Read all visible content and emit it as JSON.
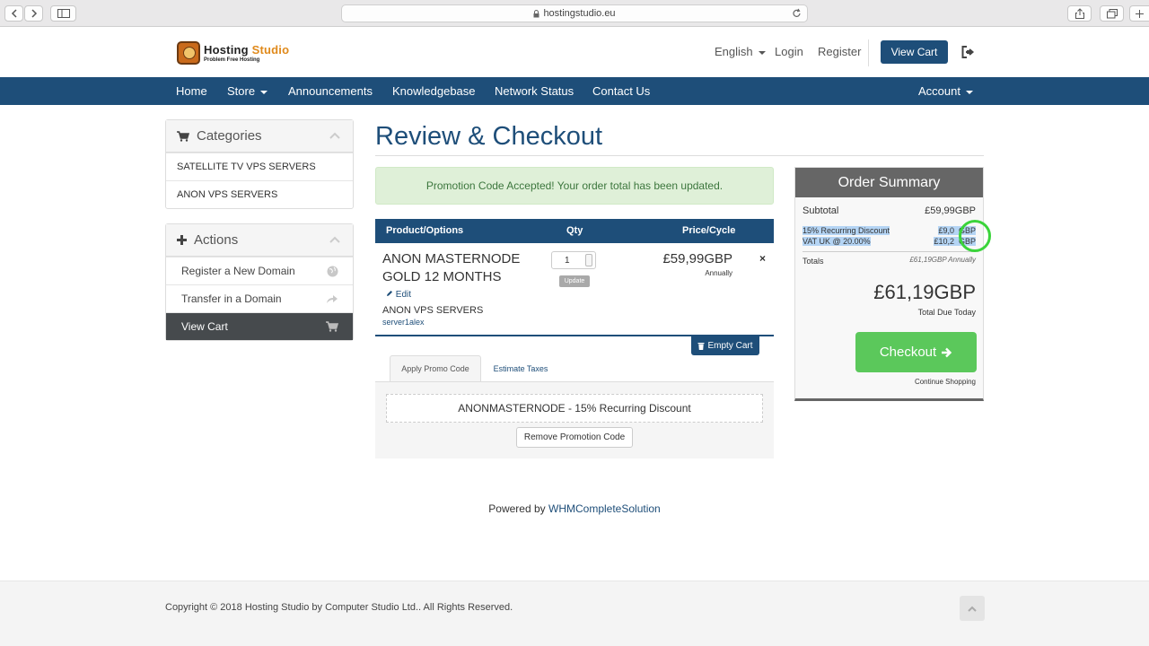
{
  "browser": {
    "url": "hostingstudio.eu"
  },
  "header": {
    "logo_title_a": "Hosting",
    "logo_title_b": "Studio",
    "logo_sub": "Problem Free Hosting",
    "language": "English",
    "login": "Login",
    "register": "Register",
    "view_cart": "View Cart"
  },
  "nav": {
    "home": "Home",
    "store": "Store",
    "announcements": "Announcements",
    "knowledgebase": "Knowledgebase",
    "network_status": "Network Status",
    "contact_us": "Contact Us",
    "account": "Account"
  },
  "sidebar": {
    "categories_title": "Categories",
    "categories": [
      "SATELLITE TV VPS SERVERS",
      "ANON VPS SERVERS"
    ],
    "actions_title": "Actions",
    "actions": [
      "Register a New Domain",
      "Transfer in a Domain",
      "View Cart"
    ]
  },
  "main": {
    "title": "Review & Checkout",
    "alert": "Promotion Code Accepted! Your order total has been updated.",
    "cart_headers": {
      "product": "Product/Options",
      "qty": "Qty",
      "price": "Price/Cycle"
    },
    "item": {
      "name": "ANON MASTERNODE GOLD 12 MONTHS",
      "edit": "Edit",
      "group": "ANON VPS SERVERS",
      "domain": "server1alex",
      "qty": "1",
      "update": "Update",
      "price": "£59,99GBP",
      "cycle": "Annually",
      "remove": "×"
    },
    "empty_cart": "Empty Cart",
    "tabs": {
      "promo": "Apply Promo Code",
      "taxes": "Estimate Taxes"
    },
    "promo_applied": "ANONMASTERNODE - 15% Recurring Discount",
    "remove_promo": "Remove Promotion Code"
  },
  "summary": {
    "title": "Order Summary",
    "subtotal_label": "Subtotal",
    "subtotal": "£59,99GBP",
    "discount_label": "15% Recurring Discount",
    "discount": "£9,0  GBP",
    "vat_label": "VAT UK @ 20.00%",
    "vat": "£10,2  GBP",
    "totals_label": "Totals",
    "totals": "£61,19GBP Annually",
    "grand_total": "£61,19GBP",
    "due_today": "Total Due Today",
    "checkout": "Checkout",
    "continue": "Continue Shopping"
  },
  "footer": {
    "powered_prefix": "Powered by",
    "powered_link": "WHMCompleteSolution",
    "copyright": "Copyright © 2018 Hosting Studio by Computer Studio Ltd.. All Rights Reserved."
  },
  "colors": {
    "brand": "#1e4e79",
    "success": "#5bc85b",
    "alert_bg": "#dff0d8"
  }
}
